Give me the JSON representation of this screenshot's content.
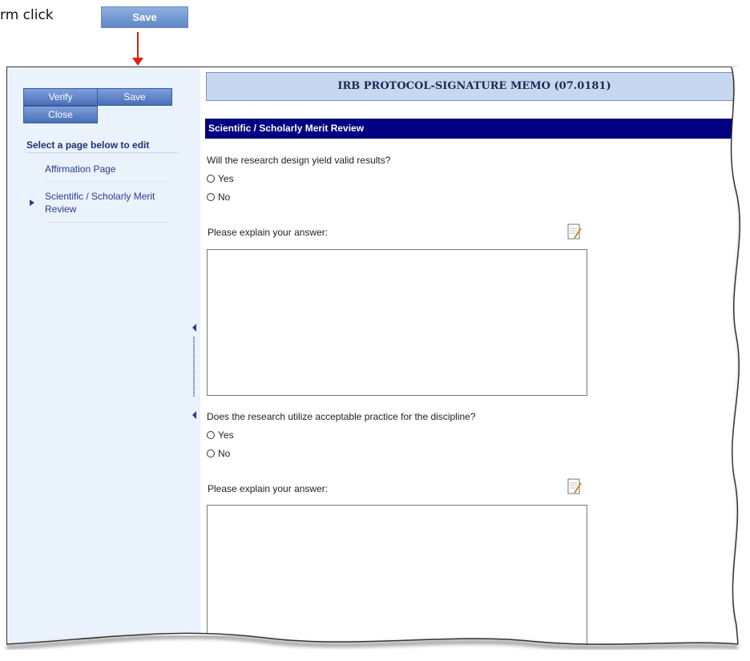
{
  "instruction": {
    "text": "rm click",
    "save_label": "Save"
  },
  "sidebar": {
    "buttons": {
      "verify": "Verify",
      "save": "Save",
      "close": "Close"
    },
    "heading": "Select a page below to edit",
    "items": [
      {
        "label": "Affirmation Page"
      },
      {
        "label": "Scientific / Scholarly Merit Review"
      }
    ]
  },
  "header": {
    "title": "IRB PROTOCOL-SIGNATURE MEMO (07.0181)"
  },
  "section": {
    "title": "Scientific / Scholarly Merit Review"
  },
  "questions": [
    {
      "text": "Will the research design yield valid results?",
      "options": [
        "Yes",
        "No"
      ],
      "explain_label": "Please explain your answer:"
    },
    {
      "text": "Does the research utilize acceptable practice for the discipline?",
      "options": [
        "Yes",
        "No"
      ],
      "explain_label": "Please explain your answer:"
    }
  ],
  "colors": {
    "section_bg": "#000080",
    "sidebar_bg": "#eaf2fb",
    "arrow": "#e41b17"
  }
}
